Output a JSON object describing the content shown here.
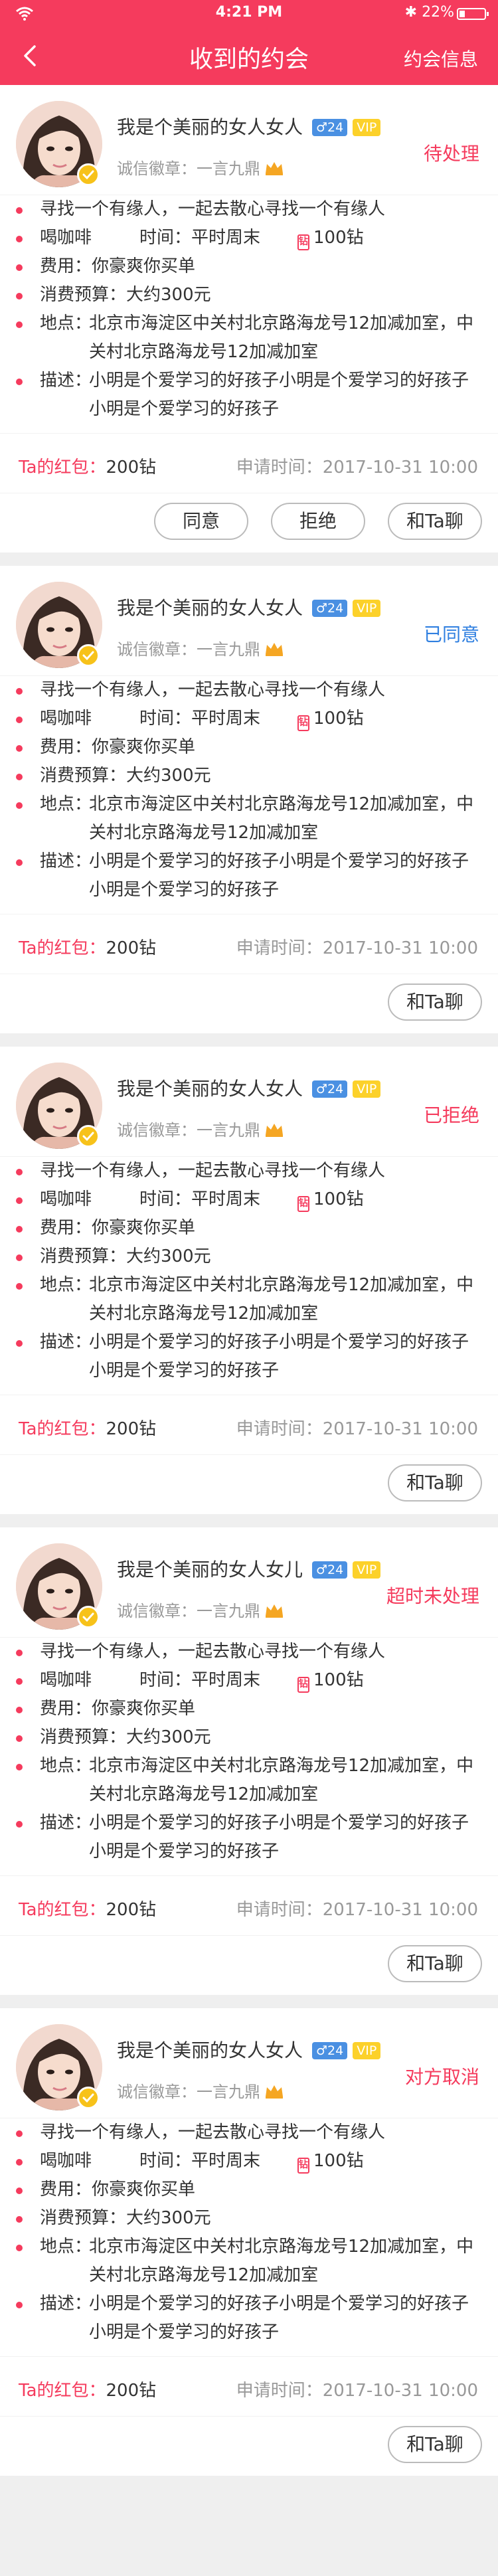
{
  "statusbar": {
    "time": "4:21 PM",
    "battery": "22%",
    "battery_level": 0.22
  },
  "nav": {
    "title": "收到的约会",
    "right": "约会信息"
  },
  "colors": {
    "accent": "#f53b5d",
    "accept": "#2f7fe0",
    "badge_blue": "#4a90e2",
    "vip": "#fcd12a"
  },
  "cards": [
    {
      "name": "我是个美丽的女人女人",
      "gender": "♂24",
      "vip": "VIP",
      "status": "待处理",
      "status_color": "#f53b5d",
      "honor": "诚信徽章：一言九鼎",
      "line1": "寻找一个有缘人，一起去散心寻找一个有缘人",
      "activity": "喝咖啡",
      "time": "时间：平时周末",
      "coin": "100钻",
      "fee": "费用：你豪爽你买单",
      "budget": "消费预算：大约300元",
      "addr_label": "地点：",
      "addr": "北京市海淀区中关村北京路海龙号12加减加室，中关村北京路海龙号12加减加室",
      "desc_label": "描述：",
      "desc": "小明是个爱学习的好孩子小明是个爱学习的好孩子小明是个爱学习的好孩子",
      "red_label": "Ta的红包：",
      "red_value": "200钻",
      "apply": "申请时间：2017-10-31  10:00",
      "btn_agree": "同意",
      "btn_refuse": "拒绝",
      "btn_chat": "和Ta聊"
    },
    {
      "name": "我是个美丽的女人女人",
      "gender": "♂24",
      "vip": "VIP",
      "status": "已同意",
      "status_color": "#2f7fe0",
      "honor": "诚信徽章：一言九鼎",
      "line1": "寻找一个有缘人，一起去散心寻找一个有缘人",
      "activity": "喝咖啡",
      "time": "时间：平时周末",
      "coin": "100钻",
      "fee": "费用：你豪爽你买单",
      "budget": "消费预算：大约300元",
      "addr_label": "地点：",
      "addr": "北京市海淀区中关村北京路海龙号12加减加室，中关村北京路海龙号12加减加室",
      "desc_label": "描述：",
      "desc": "小明是个爱学习的好孩子小明是个爱学习的好孩子小明是个爱学习的好孩子",
      "red_label": "Ta的红包：",
      "red_value": "200钻",
      "apply": "申请时间：2017-10-31  10:00",
      "btn_chat": "和Ta聊"
    },
    {
      "name": "我是个美丽的女人女人",
      "gender": "♂24",
      "vip": "VIP",
      "status": "已拒绝",
      "status_color": "#f53b5d",
      "honor": "诚信徽章：一言九鼎",
      "line1": "寻找一个有缘人，一起去散心寻找一个有缘人",
      "activity": "喝咖啡",
      "time": "时间：平时周末",
      "coin": "100钻",
      "fee": "费用：你豪爽你买单",
      "budget": "消费预算：大约300元",
      "addr_label": "地点：",
      "addr": "北京市海淀区中关村北京路海龙号12加减加室，中关村北京路海龙号12加减加室",
      "desc_label": "描述：",
      "desc": "小明是个爱学习的好孩子小明是个爱学习的好孩子小明是个爱学习的好孩子",
      "red_label": "Ta的红包：",
      "red_value": "200钻",
      "apply": "申请时间：2017-10-31  10:00",
      "btn_chat": "和Ta聊"
    },
    {
      "name": "我是个美丽的女人女儿",
      "gender": "♂24",
      "vip": "VIP",
      "status": "超时未处理",
      "status_color": "#f53b5d",
      "honor": "诚信徽章：一言九鼎",
      "line1": "寻找一个有缘人，一起去散心寻找一个有缘人",
      "activity": "喝咖啡",
      "time": "时间：平时周末",
      "coin": "100钻",
      "fee": "费用：你豪爽你买单",
      "budget": "消费预算：大约300元",
      "addr_label": "地点：",
      "addr": "北京市海淀区中关村北京路海龙号12加减加室，中关村北京路海龙号12加减加室",
      "desc_label": "描述：",
      "desc": "小明是个爱学习的好孩子小明是个爱学习的好孩子小明是个爱学习的好孩子",
      "red_label": "Ta的红包：",
      "red_value": "200钻",
      "apply": "申请时间：2017-10-31  10:00",
      "btn_chat": "和Ta聊"
    },
    {
      "name": "我是个美丽的女人女人",
      "gender": "♂24",
      "vip": "VIP",
      "status": "对方取消",
      "status_color": "#f53b5d",
      "honor": "诚信徽章：一言九鼎",
      "line1": "寻找一个有缘人，一起去散心寻找一个有缘人",
      "activity": "喝咖啡",
      "time": "时间：平时周末",
      "coin": "100钻",
      "fee": "费用：你豪爽你买单",
      "budget": "消费预算：大约300元",
      "addr_label": "地点：",
      "addr": "北京市海淀区中关村北京路海龙号12加减加室，中关村北京路海龙号12加减加室",
      "desc_label": "描述：",
      "desc": "小明是个爱学习的好孩子小明是个爱学习的好孩子小明是个爱学习的好孩子",
      "red_label": "Ta的红包：",
      "red_value": "200钻",
      "apply": "申请时间：2017-10-31  10:00",
      "btn_chat": "和Ta聊"
    }
  ]
}
